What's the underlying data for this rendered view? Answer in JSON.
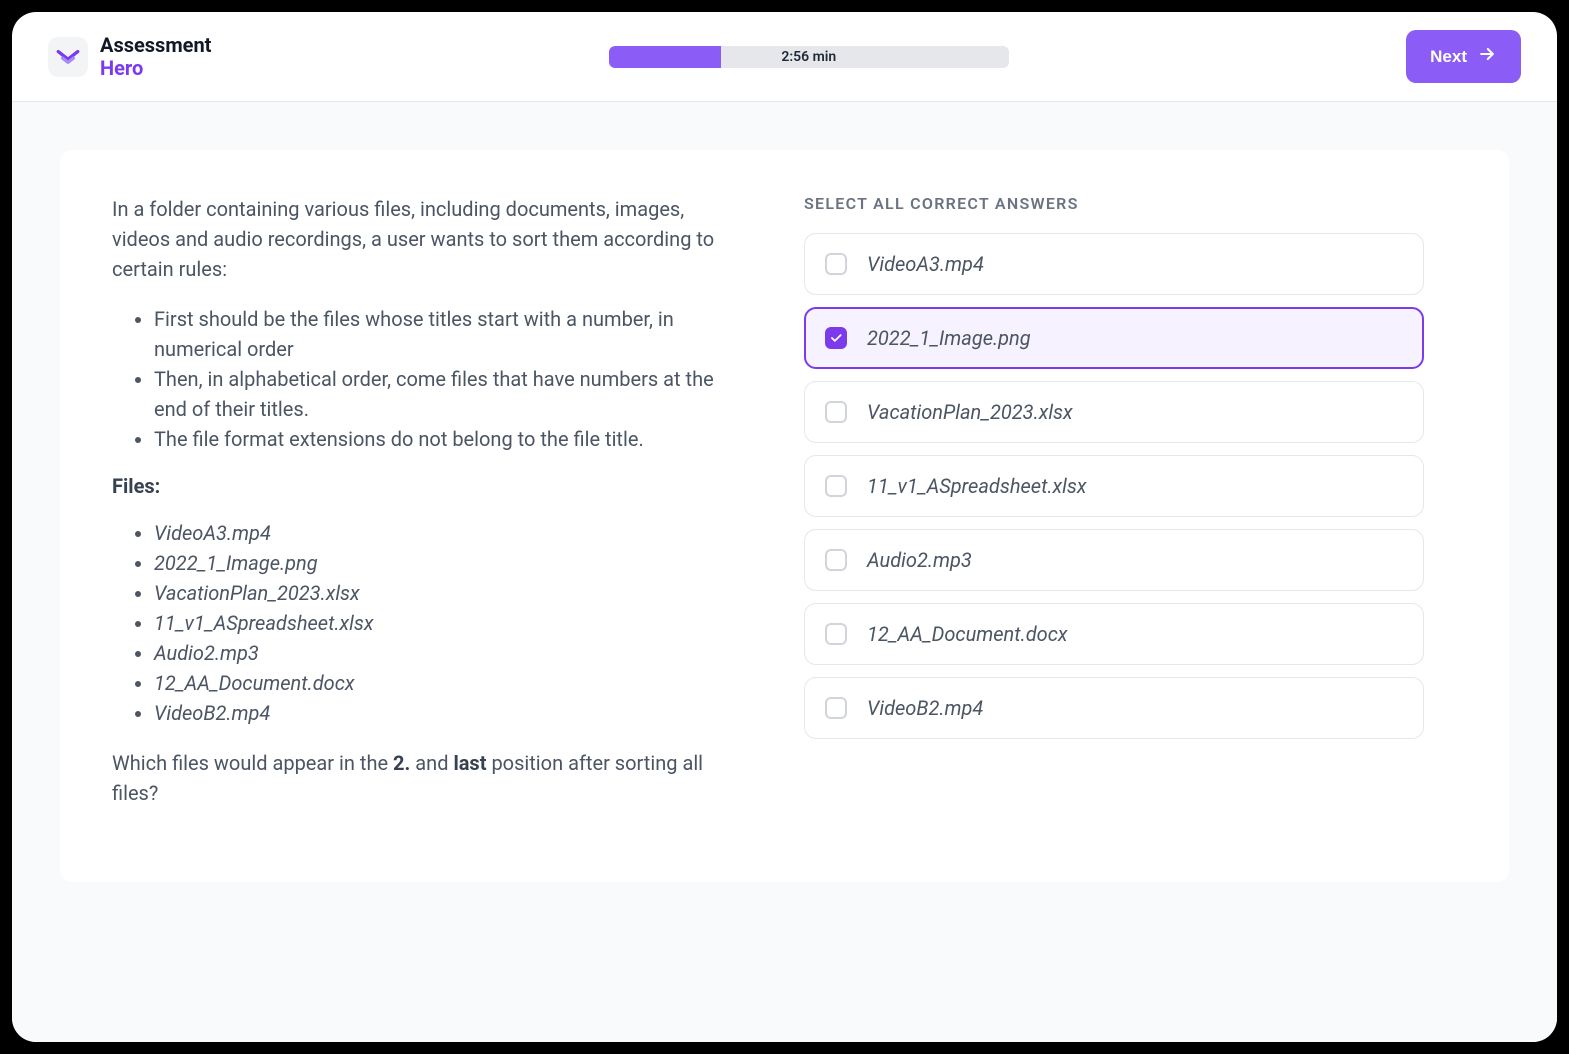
{
  "brand": {
    "line1": "Assessment",
    "line2": "Hero"
  },
  "timer": {
    "label": "2:56 min",
    "percent": 28
  },
  "actions": {
    "next": "Next"
  },
  "question": {
    "intro": "In a folder containing various files, including documents, images, videos and audio recordings, a user wants to sort them according to certain rules:",
    "rules": [
      "First should be the files whose titles start with a number, in numerical order",
      "Then, in alphabetical order, come files that have numbers at the end of their titles.",
      "The file format extensions do not belong to the file title."
    ],
    "files_heading": "Files:",
    "files": [
      "VideoA3.mp4",
      "2022_1_Image.png",
      "VacationPlan_2023.xlsx",
      "11_v1_ASpreadsheet.xlsx",
      "Audio2.mp3",
      "12_AA_Document.docx",
      "VideoB2.mp4"
    ],
    "closing_pre": "Which files would appear in the ",
    "closing_b1": "2.",
    "closing_mid": " and ",
    "closing_b2": "last",
    "closing_post": " position after sorting all files?"
  },
  "answers": {
    "heading": "SELECT ALL CORRECT ANSWERS",
    "options": [
      {
        "label": "VideoA3.mp4",
        "selected": false
      },
      {
        "label": "2022_1_Image.png",
        "selected": true
      },
      {
        "label": "VacationPlan_2023.xlsx",
        "selected": false
      },
      {
        "label": "11_v1_ASpreadsheet.xlsx",
        "selected": false
      },
      {
        "label": "Audio2.mp3",
        "selected": false
      },
      {
        "label": "12_AA_Document.docx",
        "selected": false
      },
      {
        "label": "VideoB2.mp4",
        "selected": false
      }
    ]
  }
}
